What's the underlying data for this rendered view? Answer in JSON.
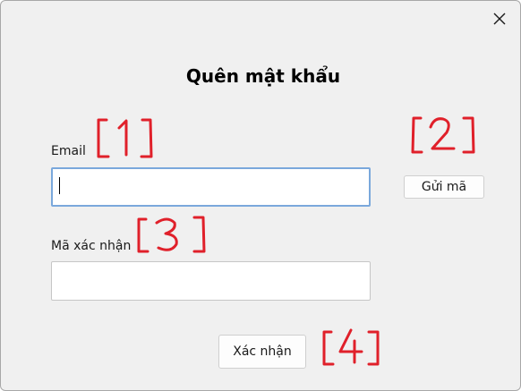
{
  "dialog": {
    "title": "Quên mật khẩu",
    "close_icon": "close-icon"
  },
  "email": {
    "label": "Email",
    "value": "",
    "placeholder": ""
  },
  "send_code": {
    "label": "Gửi mã"
  },
  "code": {
    "label": "Mã xác nhận",
    "value": "",
    "placeholder": ""
  },
  "confirm": {
    "label": "Xác nhận"
  },
  "annotations": {
    "color": "#e0202a",
    "marks": [
      "[1]",
      "[2]",
      "[3]",
      "[4]"
    ]
  },
  "colors": {
    "background": "#f0f0f0",
    "focus_border": "#7aa8dc",
    "annotation": "#e0202a"
  }
}
